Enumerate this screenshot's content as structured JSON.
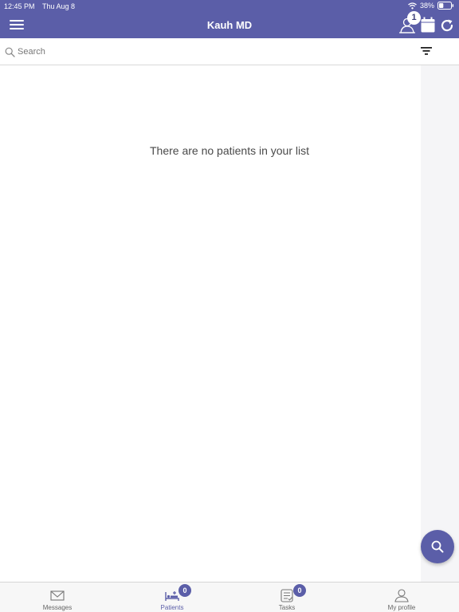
{
  "status_bar": {
    "time": "12:45 PM",
    "date": "Thu Aug 8",
    "battery": "38%",
    "battery_level": 0.38
  },
  "header": {
    "title": "Kauh MD",
    "location_badge": "1"
  },
  "search": {
    "placeholder": "Search",
    "value": ""
  },
  "main": {
    "empty_message": "There are no patients in your list"
  },
  "tabs": [
    {
      "label": "Messages",
      "icon": "envelope-icon",
      "badge": ""
    },
    {
      "label": "Patients",
      "icon": "bed-icon",
      "badge": "0",
      "active": true
    },
    {
      "label": "Tasks",
      "icon": "checklist-icon",
      "badge": "0"
    },
    {
      "label": "My profile",
      "icon": "person-icon",
      "badge": ""
    }
  ],
  "colors": {
    "primary": "#5b5ea8",
    "background": "#ffffff",
    "tabbar": "#f7f7f7",
    "text": "#4a4a4a"
  }
}
